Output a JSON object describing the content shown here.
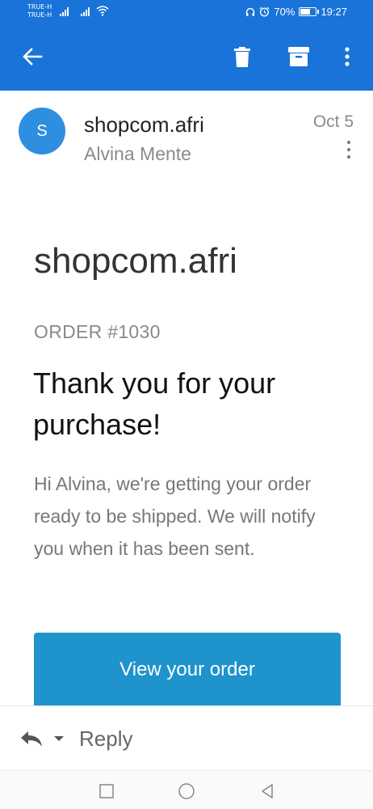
{
  "status_bar": {
    "carrier_1": "TRUE-H",
    "carrier_2": "TRUE-H",
    "battery_percent": "70%",
    "battery_level": 0.7,
    "time": "19:27",
    "icons": [
      "signal-icon",
      "wifi-icon",
      "headphones-icon",
      "alarm-icon",
      "battery-icon"
    ]
  },
  "app_bar": {
    "color": "#1a73d9",
    "icons": [
      "back-arrow-icon",
      "trash-icon",
      "archive-icon",
      "more-vert-icon"
    ]
  },
  "email": {
    "avatar_letter": "S",
    "avatar_color": "#2e8fe0",
    "sender": "shopcom.afri",
    "recipient": "Alvina Mente",
    "date": "Oct 5"
  },
  "content": {
    "shop_title": "shopcom.afri",
    "order_number": "ORDER #1030",
    "heading": "Thank you for your purchase!",
    "message": "Hi Alvina, we're getting your order ready to be shipped. We will notify you when it has been sent.",
    "button_label": "View your order",
    "button_color": "#1e93cc"
  },
  "reply_bar": {
    "label": "Reply",
    "icons": [
      "reply-icon",
      "dropdown-caret-icon"
    ]
  },
  "nav_bar": {
    "icons": [
      "recent-apps-icon",
      "home-icon",
      "back-icon"
    ]
  }
}
